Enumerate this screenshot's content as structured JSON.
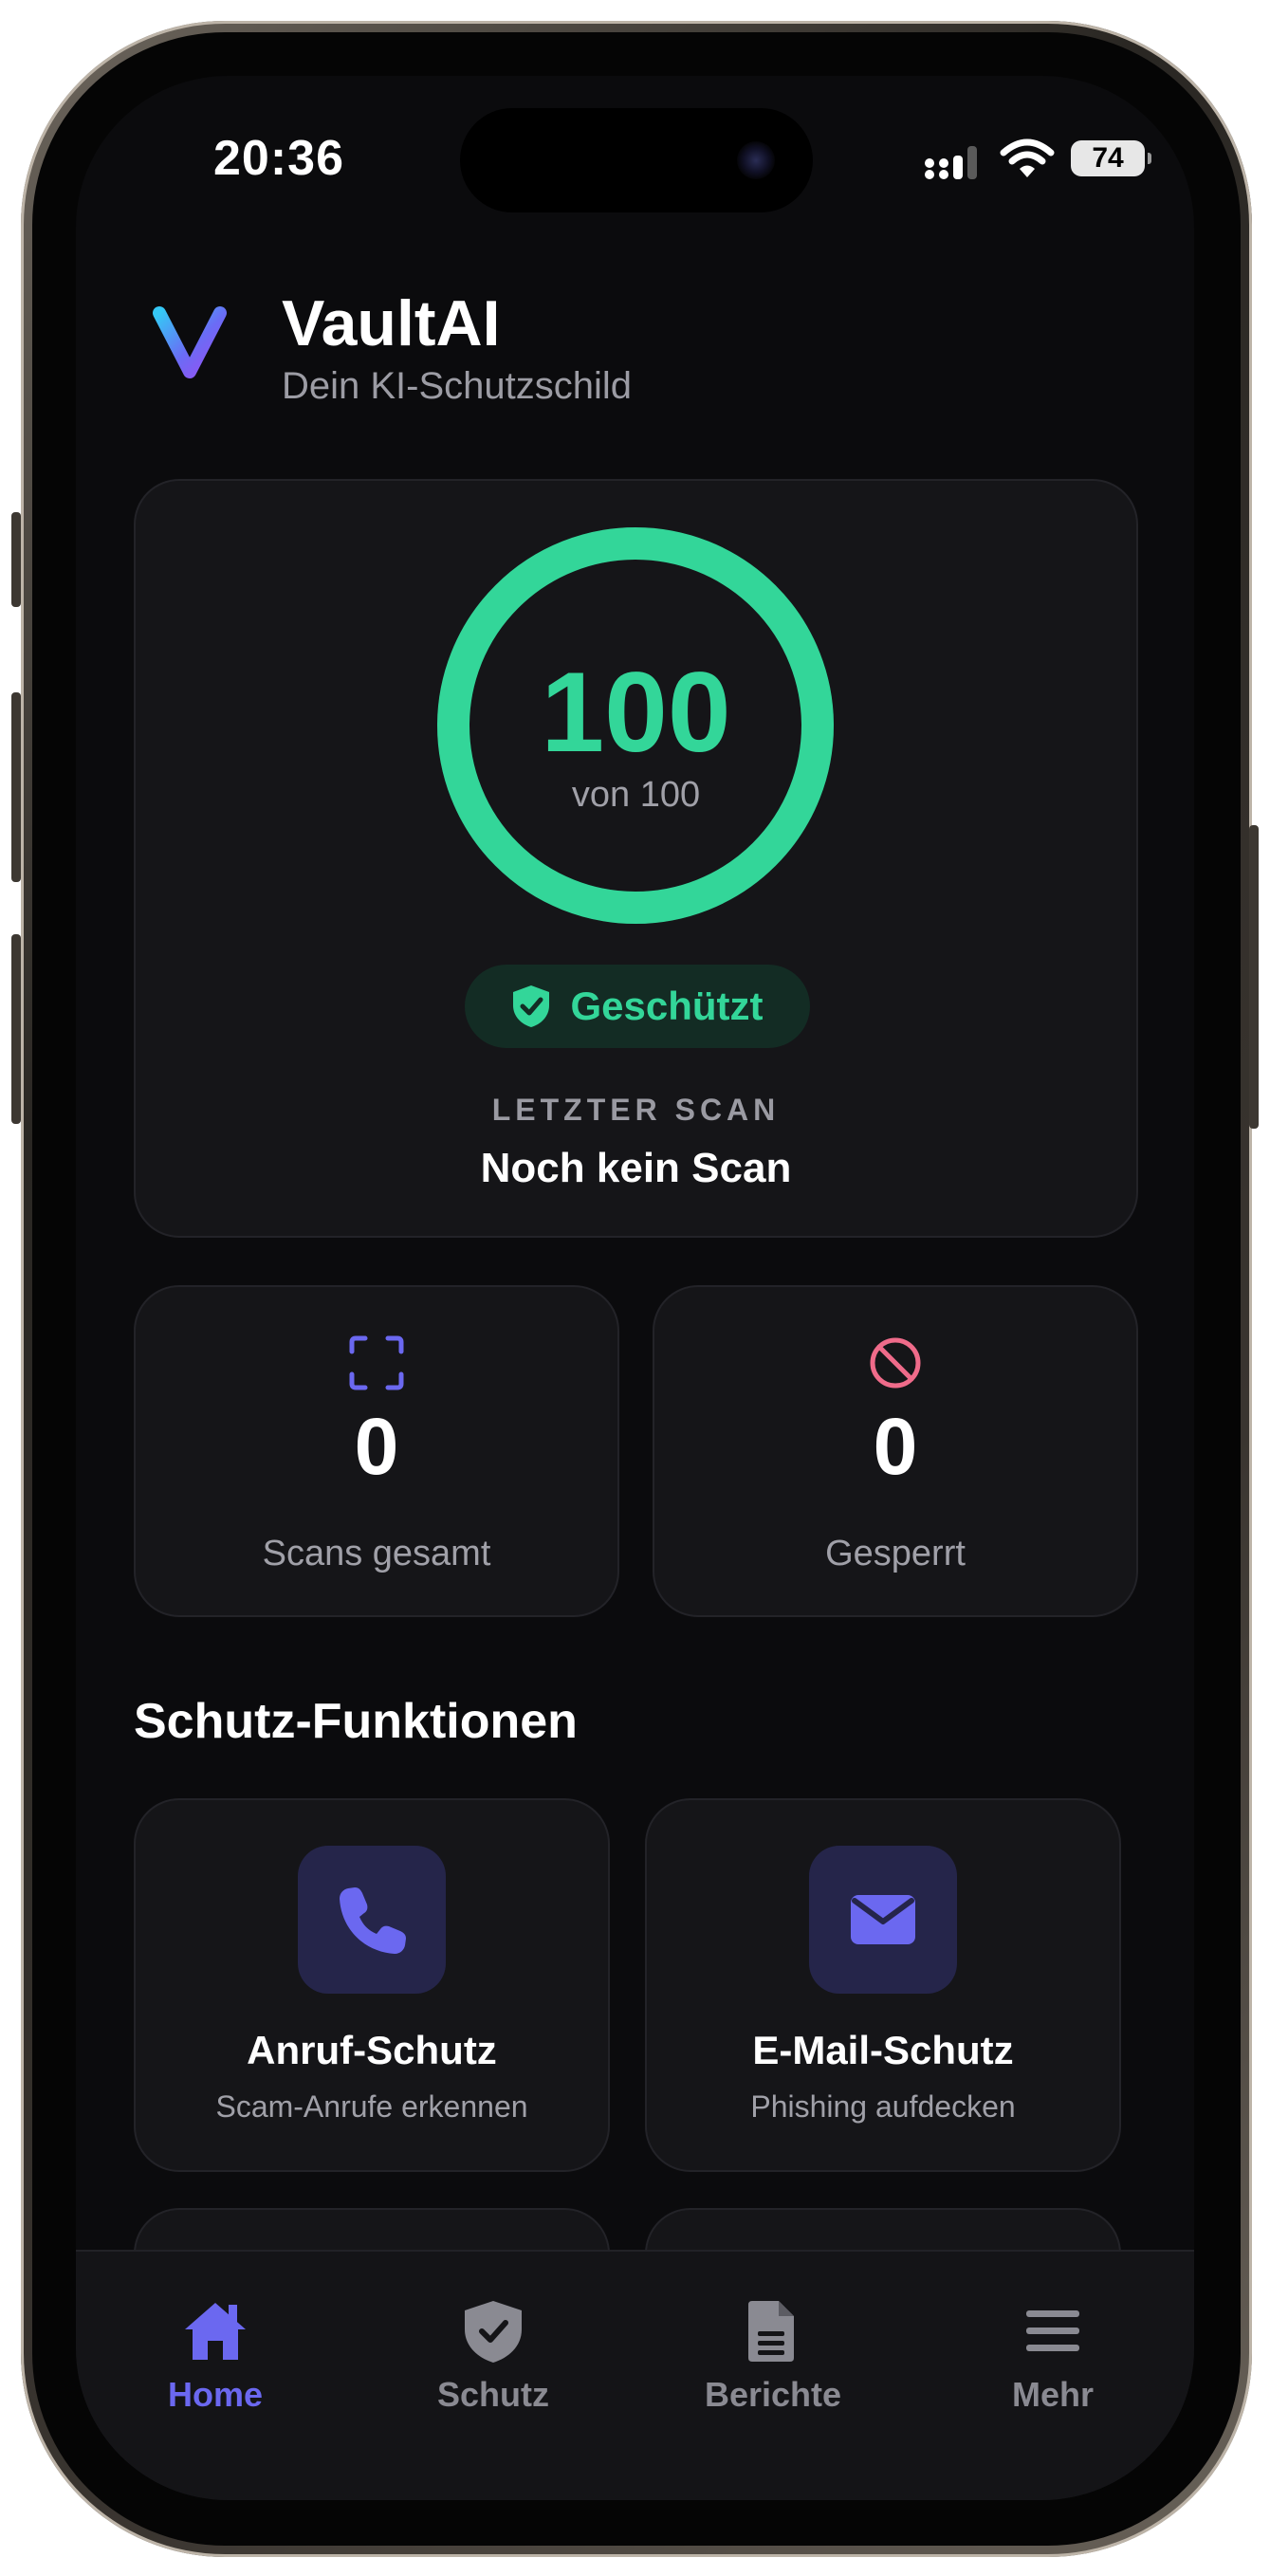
{
  "status_bar": {
    "time": "20:36",
    "battery_level": "74",
    "icons": [
      "cellular-signal-icon",
      "wifi-icon",
      "battery-icon"
    ]
  },
  "header": {
    "title": "VaultAI",
    "subtitle": "Dein KI-Schutzschild",
    "logo_icon": "vaultai-v-logo"
  },
  "score": {
    "value": "100",
    "max_label": "von 100",
    "fraction": 1.0,
    "status": "Geschützt",
    "status_icon": "shield-check-icon",
    "last_scan_label": "LETZTER SCAN",
    "last_scan_value": "Noch kein Scan"
  },
  "stats": [
    {
      "value": "0",
      "label": "Scans gesamt",
      "icon": "scan-frame-icon"
    },
    {
      "value": "0",
      "label": "Gesperrt",
      "icon": "blocked-icon"
    }
  ],
  "features": {
    "section_title": "Schutz-Funktionen",
    "items": [
      {
        "title": "Anruf-Schutz",
        "description": "Scam-Anrufe erkennen",
        "icon": "phone-icon"
      },
      {
        "title": "E-Mail-Schutz",
        "description": "Phishing aufdecken",
        "icon": "mail-icon"
      }
    ]
  },
  "tabbar": {
    "items": [
      {
        "label": "Home",
        "icon": "home-icon",
        "active": true
      },
      {
        "label": "Schutz",
        "icon": "shield-check-icon",
        "active": false
      },
      {
        "label": "Berichte",
        "icon": "document-icon",
        "active": false
      },
      {
        "label": "Mehr",
        "icon": "menu-icon",
        "active": false
      }
    ]
  },
  "colors": {
    "accent_green": "#33d699",
    "accent_purple": "#6b68f0",
    "danger_pink": "#ef6b8a",
    "background": "#0b0b0d",
    "card": "#151518"
  }
}
